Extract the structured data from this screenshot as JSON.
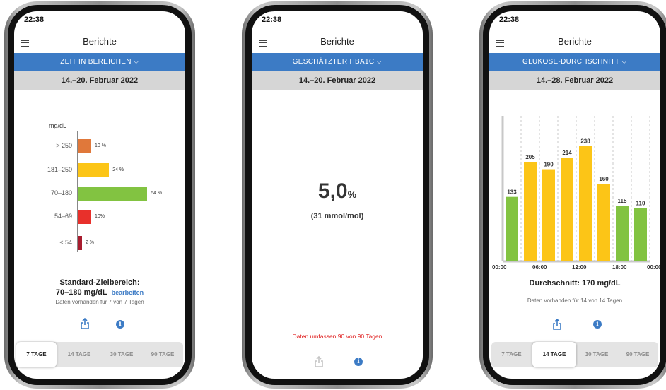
{
  "colors": {
    "header_blue": "#3c7bc5",
    "very_high": "#e0783a",
    "high": "#fcc517",
    "in_range": "#82c341",
    "low": "#e8302b",
    "very_low": "#a81c2e",
    "avg_green": "#82c341",
    "avg_yellow": "#fcc517"
  },
  "screens": [
    {
      "status_time": "22:38",
      "title": "Berichte",
      "report_selector": "ZEIT IN BEREICHEN ⌵",
      "date_range": "14.–20. Februar 2022",
      "unit": "mg/dL",
      "ranges": [
        {
          "label": "> 250",
          "pct_label": "10 %",
          "value": 10,
          "color_key": "very_high"
        },
        {
          "label": "181–250",
          "pct_label": "24 %",
          "value": 24,
          "color_key": "high"
        },
        {
          "label": "70–180",
          "pct_label": "54 %",
          "value": 54,
          "color_key": "in_range"
        },
        {
          "label": "54–69",
          "pct_label": "10%",
          "value": 10,
          "color_key": "low"
        },
        {
          "label": "< 54",
          "pct_label": "2 %",
          "value": 2,
          "color_key": "very_low"
        }
      ],
      "target_title": "Standard-Zielbereich:",
      "target_range": "70–180 mg/dL",
      "edit_label": "bearbeiten",
      "data_available": "Daten vorhanden für 7 von 7 Tagen",
      "share_icon": "share-icon",
      "info_icon": "info-icon",
      "tabs": [
        "7 TAGE",
        "14 TAGE",
        "30 TAGE",
        "90 TAGE"
      ],
      "active_tab": 0
    },
    {
      "status_time": "22:38",
      "title": "Berichte",
      "report_selector": "GESCHÄTZTER HBA1C ⌵",
      "date_range": "14.–20. Februar 2022",
      "hba1c_value": "5,0",
      "hba1c_unit": "%",
      "mmol": "(31 mmol/mol)",
      "note": "Daten umfassen 90 von 90 Tagen",
      "share_icon": "share-icon",
      "info_icon": "info-icon"
    },
    {
      "status_time": "22:38",
      "title": "Berichte",
      "report_selector": "GLUKOSE-DURCHSCHNITT ⌵",
      "date_range": "14.–28. Februar 2022",
      "average": "Durchschnitt: 170 mg/dL",
      "data_available": "Daten vorhanden für 14 von 14 Tagen",
      "share_icon": "share-icon",
      "info_icon": "info-icon",
      "tabs": [
        "7 TAGE",
        "14 TAGE",
        "30 TAGE",
        "90 TAGE"
      ],
      "active_tab": 1
    }
  ],
  "chart_data": {
    "type": "bar",
    "categories": [
      "00:00-03:00",
      "03:00-06:00",
      "06:00-09:00",
      "09:00-12:00",
      "12:00-15:00",
      "15:00-18:00",
      "18:00-21:00",
      "21:00-00:00"
    ],
    "values": [
      133,
      205,
      190,
      214,
      238,
      160,
      115,
      110
    ],
    "value_labels": [
      "133",
      "205",
      "190",
      "214",
      "238",
      "160",
      "115",
      "110"
    ],
    "bar_colors": [
      "green",
      "yellow",
      "yellow",
      "yellow",
      "yellow",
      "yellow",
      "green",
      "green"
    ],
    "xticks": [
      "00:00",
      "06:00",
      "12:00",
      "18:00",
      "00:00"
    ],
    "ylim": [
      0,
      300
    ],
    "grid": "vertical dashed"
  }
}
